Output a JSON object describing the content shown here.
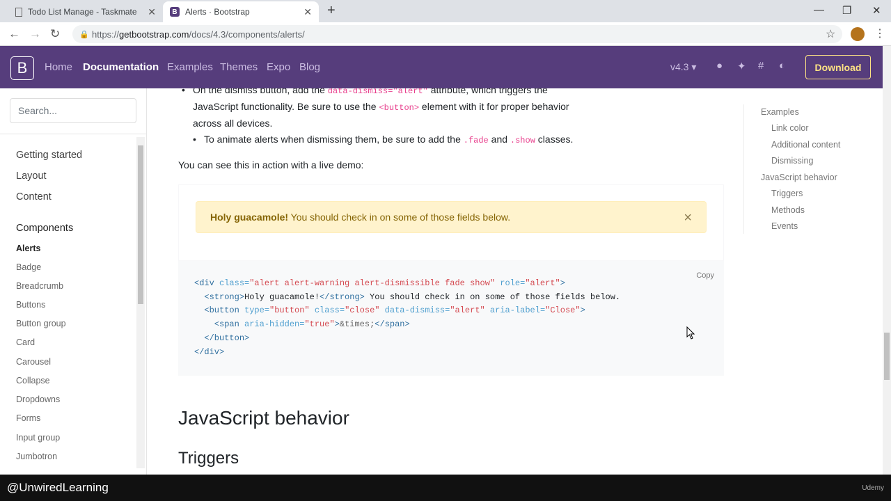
{
  "browser": {
    "tabs": [
      {
        "title": "Todo List Manage - Taskmate",
        "icon": "page-icon"
      },
      {
        "title": "Alerts · Bootstrap",
        "icon": "bootstrap-favicon",
        "active": true
      }
    ],
    "close_glyph": "✕",
    "new_tab_glyph": "+",
    "url_prefix": "https://",
    "url_host": "getbootstrap.com",
    "url_path": "/docs/4.3/components/alerts/"
  },
  "navbar": {
    "brand": "B",
    "links": [
      "Home",
      "Documentation",
      "Examples",
      "Themes",
      "Expo",
      "Blog"
    ],
    "active": "Documentation",
    "version": "v4.3 ▾",
    "download": "Download"
  },
  "sidebar": {
    "search_placeholder": "Search...",
    "sections": [
      "Getting started",
      "Layout",
      "Content",
      "Components"
    ],
    "components": [
      "Alerts",
      "Badge",
      "Breadcrumb",
      "Buttons",
      "Button group",
      "Card",
      "Carousel",
      "Collapse",
      "Dropdowns",
      "Forms",
      "Input group",
      "Jumbotron"
    ]
  },
  "content": {
    "bullet1_a": "On the dismiss button, add the ",
    "bullet1_code": "data-dismiss=\"alert\"",
    "bullet1_b": " attribute, which triggers the",
    "bullet1_c": "JavaScript functionality. Be sure to use the ",
    "bullet1_code2": "<button>",
    "bullet1_d": " element with it for proper behavior",
    "bullet1_e": "across all devices.",
    "bullet2_a": "To animate alerts when dismissing them, be sure to add the ",
    "bullet2_code1": ".fade",
    "bullet2_and": " and ",
    "bullet2_code2": ".show",
    "bullet2_b": " classes.",
    "live_demo": "You can see this in action with a live demo:",
    "alert_strong": "Holy guacamole!",
    "alert_text": " You should check in on some of those fields below.",
    "alert_close": "×",
    "copy": "Copy",
    "code_lines": [
      [
        [
          "tag",
          "<div "
        ],
        [
          "attr",
          "class="
        ],
        [
          "str",
          "\"alert alert-warning alert-dismissible fade show\""
        ],
        [
          "attr",
          " role="
        ],
        [
          "str",
          "\"alert\""
        ],
        [
          "tag",
          ">"
        ]
      ],
      [
        [
          "text",
          "  "
        ],
        [
          "tag",
          "<strong>"
        ],
        [
          "text",
          "Holy guacamole!"
        ],
        [
          "tag",
          "</strong>"
        ],
        [
          "text",
          " You should check in on some of those fields below."
        ]
      ],
      [
        [
          "text",
          "  "
        ],
        [
          "tag",
          "<button "
        ],
        [
          "attr",
          "type="
        ],
        [
          "str",
          "\"button\""
        ],
        [
          "attr",
          " class="
        ],
        [
          "str",
          "\"close\""
        ],
        [
          "attr",
          " data-dismiss="
        ],
        [
          "str",
          "\"alert\""
        ],
        [
          "attr",
          " aria-label="
        ],
        [
          "str",
          "\"Close\""
        ],
        [
          "tag",
          ">"
        ]
      ],
      [
        [
          "text",
          "    "
        ],
        [
          "tag",
          "<span "
        ],
        [
          "attr",
          "aria-hidden="
        ],
        [
          "str",
          "\"true\""
        ],
        [
          "tag",
          ">"
        ],
        [
          "ent",
          "&times;"
        ],
        [
          "tag",
          "</span>"
        ]
      ],
      [
        [
          "text",
          "  "
        ],
        [
          "tag",
          "</button>"
        ]
      ],
      [
        [
          "tag",
          "</div>"
        ]
      ]
    ],
    "h2": "JavaScript behavior",
    "h3": "Triggers"
  },
  "toc": [
    {
      "label": "Examples",
      "level": 1
    },
    {
      "label": "Link color",
      "level": 2
    },
    {
      "label": "Additional content",
      "level": 2
    },
    {
      "label": "Dismissing",
      "level": 2
    },
    {
      "label": "JavaScript behavior",
      "level": 1
    },
    {
      "label": "Triggers",
      "level": 2
    },
    {
      "label": "Methods",
      "level": 2
    },
    {
      "label": "Events",
      "level": 2
    }
  ],
  "footer": {
    "watermark": "@UnwiredLearning",
    "brand": "Udemy"
  }
}
